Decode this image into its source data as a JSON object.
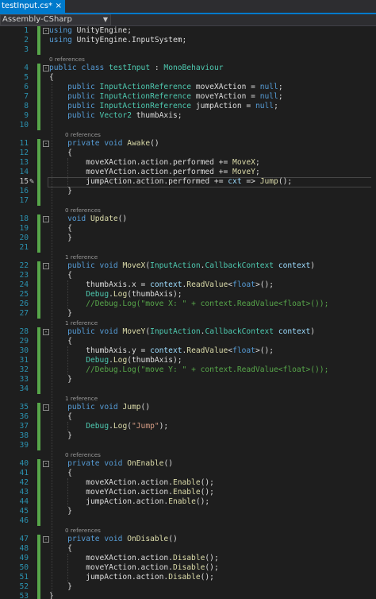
{
  "tab": {
    "title": "testInput.cs*",
    "close_glyph": "×"
  },
  "project_selector": {
    "value": "Assembly-CSharp"
  },
  "gutter": {
    "edit_icon": "pencil-icon",
    "current_line": 15
  },
  "lens": {
    "l4": "0 references",
    "l11": "0 references",
    "l18": "0 references",
    "l22": "1 reference",
    "l28": "1 reference",
    "l35": "1 reference",
    "l40": "0 references",
    "l47": "0 references"
  },
  "code": [
    {
      "n": "1",
      "fold": "-",
      "t": [
        [
          "kw",
          "using"
        ],
        [
          "pu",
          " UnityEngine;"
        ]
      ]
    },
    {
      "n": "2",
      "t": [
        [
          "kw",
          "using"
        ],
        [
          "pu",
          " UnityEngine.InputSystem;"
        ]
      ]
    },
    {
      "n": "3",
      "t": []
    },
    {
      "n": "4",
      "fold": "-",
      "lens": "l4",
      "t": [
        [
          "kw",
          "public"
        ],
        [
          "pu",
          " "
        ],
        [
          "kw",
          "class"
        ],
        [
          "pu",
          " "
        ],
        [
          "ty",
          "testInput"
        ],
        [
          "pu",
          " : "
        ],
        [
          "ty",
          "MonoBehaviour"
        ]
      ]
    },
    {
      "n": "5",
      "t": [
        [
          "pu",
          "{"
        ]
      ]
    },
    {
      "n": "6",
      "t": [
        [
          "pu",
          "    "
        ],
        [
          "kw",
          "public"
        ],
        [
          "pu",
          " "
        ],
        [
          "ty",
          "InputActionReference"
        ],
        [
          "pu",
          " moveXAction = "
        ],
        [
          "kw",
          "null"
        ],
        [
          "pu",
          ";"
        ]
      ]
    },
    {
      "n": "7",
      "t": [
        [
          "pu",
          "    "
        ],
        [
          "kw",
          "public"
        ],
        [
          "pu",
          " "
        ],
        [
          "ty",
          "InputActionReference"
        ],
        [
          "pu",
          " moveYAction = "
        ],
        [
          "kw",
          "null"
        ],
        [
          "pu",
          ";"
        ]
      ]
    },
    {
      "n": "8",
      "t": [
        [
          "pu",
          "    "
        ],
        [
          "kw",
          "public"
        ],
        [
          "pu",
          " "
        ],
        [
          "ty",
          "InputActionReference"
        ],
        [
          "pu",
          " jumpAction = "
        ],
        [
          "kw",
          "null"
        ],
        [
          "pu",
          ";"
        ]
      ]
    },
    {
      "n": "9",
      "t": [
        [
          "pu",
          "    "
        ],
        [
          "kw",
          "public"
        ],
        [
          "pu",
          " "
        ],
        [
          "ty",
          "Vector2"
        ],
        [
          "pu",
          " thumbAxis;"
        ]
      ]
    },
    {
      "n": "10",
      "t": []
    },
    {
      "n": "11",
      "fold": "-",
      "lens": "l11",
      "t": [
        [
          "pu",
          "    "
        ],
        [
          "kw",
          "private"
        ],
        [
          "pu",
          " "
        ],
        [
          "kw",
          "void"
        ],
        [
          "pu",
          " "
        ],
        [
          "fn",
          "Awake"
        ],
        [
          "pu",
          "()"
        ]
      ]
    },
    {
      "n": "12",
      "t": [
        [
          "pu",
          "    {"
        ]
      ]
    },
    {
      "n": "13",
      "t": [
        [
          "pu",
          "        moveXAction.action.performed += "
        ],
        [
          "fn",
          "MoveX"
        ],
        [
          "pu",
          ";"
        ]
      ]
    },
    {
      "n": "14",
      "t": [
        [
          "pu",
          "        moveYAction.action.performed += "
        ],
        [
          "fn",
          "MoveY"
        ],
        [
          "pu",
          ";"
        ]
      ]
    },
    {
      "n": "15",
      "cur": true,
      "t": [
        [
          "pu",
          "        jumpAction.action.performed += "
        ],
        [
          "va",
          "cxt"
        ],
        [
          "pu",
          " => "
        ],
        [
          "fn",
          "Jump"
        ],
        [
          "pu",
          "();"
        ]
      ]
    },
    {
      "n": "16",
      "t": [
        [
          "pu",
          "    }"
        ]
      ]
    },
    {
      "n": "17",
      "t": []
    },
    {
      "n": "18",
      "fold": "-",
      "lens": "l18",
      "t": [
        [
          "pu",
          "    "
        ],
        [
          "kw",
          "void"
        ],
        [
          "pu",
          " "
        ],
        [
          "fn",
          "Update"
        ],
        [
          "pu",
          "()"
        ]
      ]
    },
    {
      "n": "19",
      "t": [
        [
          "pu",
          "    {"
        ]
      ]
    },
    {
      "n": "20",
      "t": [
        [
          "pu",
          "    }"
        ]
      ]
    },
    {
      "n": "21",
      "t": []
    },
    {
      "n": "22",
      "fold": "-",
      "lens": "l22",
      "t": [
        [
          "pu",
          "    "
        ],
        [
          "kw",
          "public"
        ],
        [
          "pu",
          " "
        ],
        [
          "kw",
          "void"
        ],
        [
          "pu",
          " "
        ],
        [
          "fn",
          "MoveX"
        ],
        [
          "pu",
          "("
        ],
        [
          "ty",
          "InputAction"
        ],
        [
          "pu",
          "."
        ],
        [
          "ty",
          "CallbackContext"
        ],
        [
          "pu",
          " "
        ],
        [
          "va",
          "context"
        ],
        [
          "pu",
          ")"
        ]
      ]
    },
    {
      "n": "23",
      "t": [
        [
          "pu",
          "    {"
        ]
      ]
    },
    {
      "n": "24",
      "t": [
        [
          "pu",
          "        thumbAxis.x = "
        ],
        [
          "va",
          "context"
        ],
        [
          "pu",
          "."
        ],
        [
          "fn",
          "ReadValue"
        ],
        [
          "pu",
          "<"
        ],
        [
          "kw",
          "float"
        ],
        [
          "pu",
          ">();"
        ]
      ]
    },
    {
      "n": "25",
      "t": [
        [
          "pu",
          "        "
        ],
        [
          "ty",
          "Debug"
        ],
        [
          "pu",
          "."
        ],
        [
          "fn",
          "Log"
        ],
        [
          "pu",
          "(thumbAxis);"
        ]
      ]
    },
    {
      "n": "26",
      "t": [
        [
          "pu",
          "        "
        ],
        [
          "cm",
          "//Debug.Log(\"move X: \" + context.ReadValue<float>());"
        ]
      ]
    },
    {
      "n": "27",
      "t": [
        [
          "pu",
          "    }"
        ]
      ]
    },
    {
      "n": "28",
      "fold": "-",
      "lens": "l28",
      "t": [
        [
          "pu",
          "    "
        ],
        [
          "kw",
          "public"
        ],
        [
          "pu",
          " "
        ],
        [
          "kw",
          "void"
        ],
        [
          "pu",
          " "
        ],
        [
          "fn",
          "MoveY"
        ],
        [
          "pu",
          "("
        ],
        [
          "ty",
          "InputAction"
        ],
        [
          "pu",
          "."
        ],
        [
          "ty",
          "CallbackContext"
        ],
        [
          "pu",
          " "
        ],
        [
          "va",
          "context"
        ],
        [
          "pu",
          ")"
        ]
      ]
    },
    {
      "n": "29",
      "t": [
        [
          "pu",
          "    {"
        ]
      ]
    },
    {
      "n": "30",
      "t": [
        [
          "pu",
          "        thumbAxis.y = "
        ],
        [
          "va",
          "context"
        ],
        [
          "pu",
          "."
        ],
        [
          "fn",
          "ReadValue"
        ],
        [
          "pu",
          "<"
        ],
        [
          "kw",
          "float"
        ],
        [
          "pu",
          ">();"
        ]
      ]
    },
    {
      "n": "31",
      "t": [
        [
          "pu",
          "        "
        ],
        [
          "ty",
          "Debug"
        ],
        [
          "pu",
          "."
        ],
        [
          "fn",
          "Log"
        ],
        [
          "pu",
          "(thumbAxis);"
        ]
      ]
    },
    {
      "n": "32",
      "t": [
        [
          "pu",
          "        "
        ],
        [
          "cm",
          "//Debug.Log(\"move Y: \" + context.ReadValue<float>());"
        ]
      ]
    },
    {
      "n": "33",
      "t": [
        [
          "pu",
          "    }"
        ]
      ]
    },
    {
      "n": "34",
      "t": []
    },
    {
      "n": "35",
      "fold": "-",
      "lens": "l35",
      "t": [
        [
          "pu",
          "    "
        ],
        [
          "kw",
          "public"
        ],
        [
          "pu",
          " "
        ],
        [
          "kw",
          "void"
        ],
        [
          "pu",
          " "
        ],
        [
          "fn",
          "Jump"
        ],
        [
          "pu",
          "()"
        ]
      ]
    },
    {
      "n": "36",
      "t": [
        [
          "pu",
          "    {"
        ]
      ]
    },
    {
      "n": "37",
      "t": [
        [
          "pu",
          "        "
        ],
        [
          "ty",
          "Debug"
        ],
        [
          "pu",
          "."
        ],
        [
          "fn",
          "Log"
        ],
        [
          "pu",
          "("
        ],
        [
          "st",
          "\"Jump\""
        ],
        [
          "pu",
          ");"
        ]
      ]
    },
    {
      "n": "38",
      "t": [
        [
          "pu",
          "    }"
        ]
      ]
    },
    {
      "n": "39",
      "t": []
    },
    {
      "n": "40",
      "fold": "-",
      "lens": "l40",
      "t": [
        [
          "pu",
          "    "
        ],
        [
          "kw",
          "private"
        ],
        [
          "pu",
          " "
        ],
        [
          "kw",
          "void"
        ],
        [
          "pu",
          " "
        ],
        [
          "fn",
          "OnEnable"
        ],
        [
          "pu",
          "()"
        ]
      ]
    },
    {
      "n": "41",
      "t": [
        [
          "pu",
          "    {"
        ]
      ]
    },
    {
      "n": "42",
      "t": [
        [
          "pu",
          "        moveXAction.action."
        ],
        [
          "fn",
          "Enable"
        ],
        [
          "pu",
          "();"
        ]
      ]
    },
    {
      "n": "43",
      "t": [
        [
          "pu",
          "        moveYAction.action."
        ],
        [
          "fn",
          "Enable"
        ],
        [
          "pu",
          "();"
        ]
      ]
    },
    {
      "n": "44",
      "t": [
        [
          "pu",
          "        jumpAction.action."
        ],
        [
          "fn",
          "Enable"
        ],
        [
          "pu",
          "();"
        ]
      ]
    },
    {
      "n": "45",
      "t": [
        [
          "pu",
          "    }"
        ]
      ]
    },
    {
      "n": "46",
      "t": []
    },
    {
      "n": "47",
      "fold": "-",
      "lens": "l47",
      "t": [
        [
          "pu",
          "    "
        ],
        [
          "kw",
          "private"
        ],
        [
          "pu",
          " "
        ],
        [
          "kw",
          "void"
        ],
        [
          "pu",
          " "
        ],
        [
          "fn",
          "OnDisable"
        ],
        [
          "pu",
          "()"
        ]
      ]
    },
    {
      "n": "48",
      "t": [
        [
          "pu",
          "    {"
        ]
      ]
    },
    {
      "n": "49",
      "t": [
        [
          "pu",
          "        moveXAction.action."
        ],
        [
          "fn",
          "Disable"
        ],
        [
          "pu",
          "();"
        ]
      ]
    },
    {
      "n": "50",
      "t": [
        [
          "pu",
          "        moveYAction.action."
        ],
        [
          "fn",
          "Disable"
        ],
        [
          "pu",
          "();"
        ]
      ]
    },
    {
      "n": "51",
      "t": [
        [
          "pu",
          "        jumpAction.action."
        ],
        [
          "fn",
          "Disable"
        ],
        [
          "pu",
          "();"
        ]
      ]
    },
    {
      "n": "52",
      "t": [
        [
          "pu",
          "    }"
        ]
      ]
    },
    {
      "n": "53",
      "t": [
        [
          "pu",
          "}"
        ]
      ]
    }
  ]
}
